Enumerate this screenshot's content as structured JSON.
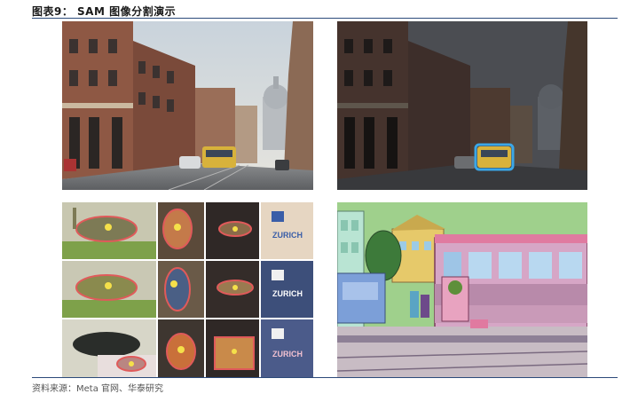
{
  "figure": {
    "title": "图表9：  SAM 图像分割演示",
    "source": "资料来源：Meta 官网、华泰研究"
  },
  "panels": [
    {
      "name": "street-scene-original"
    },
    {
      "name": "street-scene-tram-segmented"
    },
    {
      "name": "object-mask-grid"
    },
    {
      "name": "tram-scene-full-segmentation"
    }
  ],
  "grid_sign_text": "ZURICH"
}
